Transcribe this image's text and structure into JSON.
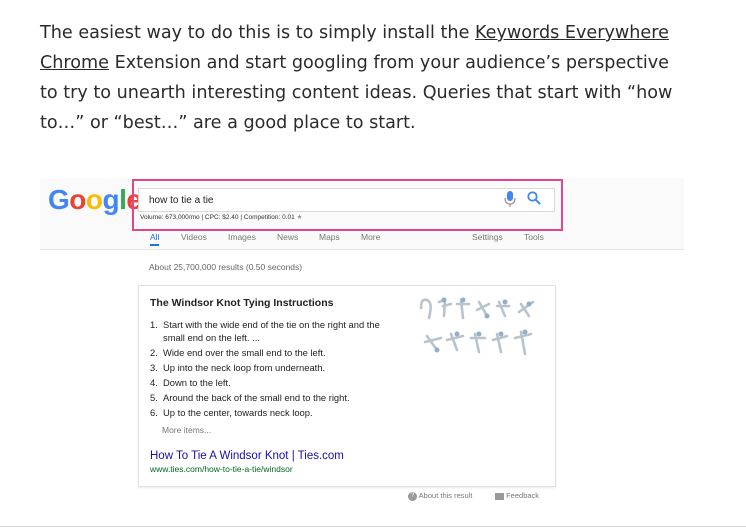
{
  "article": {
    "text_before": "The easiest way to do this is to simply install the ",
    "link_text": "Keywords Everywhere Chrome",
    "text_after": " Extension and start googling from your audience’s perspective to try to unearth interesting content ideas. Queries that start with “how to…” or “best…” are a good place to start."
  },
  "screenshot": {
    "search_query": "how to tie a tie",
    "keyword_volume": "Volume: 673,000/mo | CPC: $2.40 | Competition: 0.01",
    "nav": [
      "All",
      "Videos",
      "Images",
      "News",
      "Maps",
      "More",
      "Settings",
      "Tools"
    ],
    "result_stats": "About 25,700,000 results (0.50 seconds)",
    "snippet": {
      "title": "The Windsor Knot Tying Instructions",
      "steps": [
        {
          "num": "1.",
          "text": "Start with the wide end of the tie on the right and the small end on the left. ..."
        },
        {
          "num": "2.",
          "text": "Wide end over the small end to the left."
        },
        {
          "num": "3.",
          "text": "Up into the neck loop from underneath."
        },
        {
          "num": "4.",
          "text": "Down to the left."
        },
        {
          "num": "5.",
          "text": "Around the back of the small end to the right."
        },
        {
          "num": "6.",
          "text": "Up to the center, towards neck loop."
        }
      ],
      "more": "More items...",
      "link_title": "How To Tie A Windsor Knot | Ties.com",
      "url": "www.ties.com/how-to-tie-a-tie/windsor"
    },
    "footer": {
      "about": "About this result",
      "feedback": "Feedback"
    }
  },
  "colors": {
    "highlight": "#e2468a",
    "link": "#1a0dab",
    "url": "#006621"
  }
}
